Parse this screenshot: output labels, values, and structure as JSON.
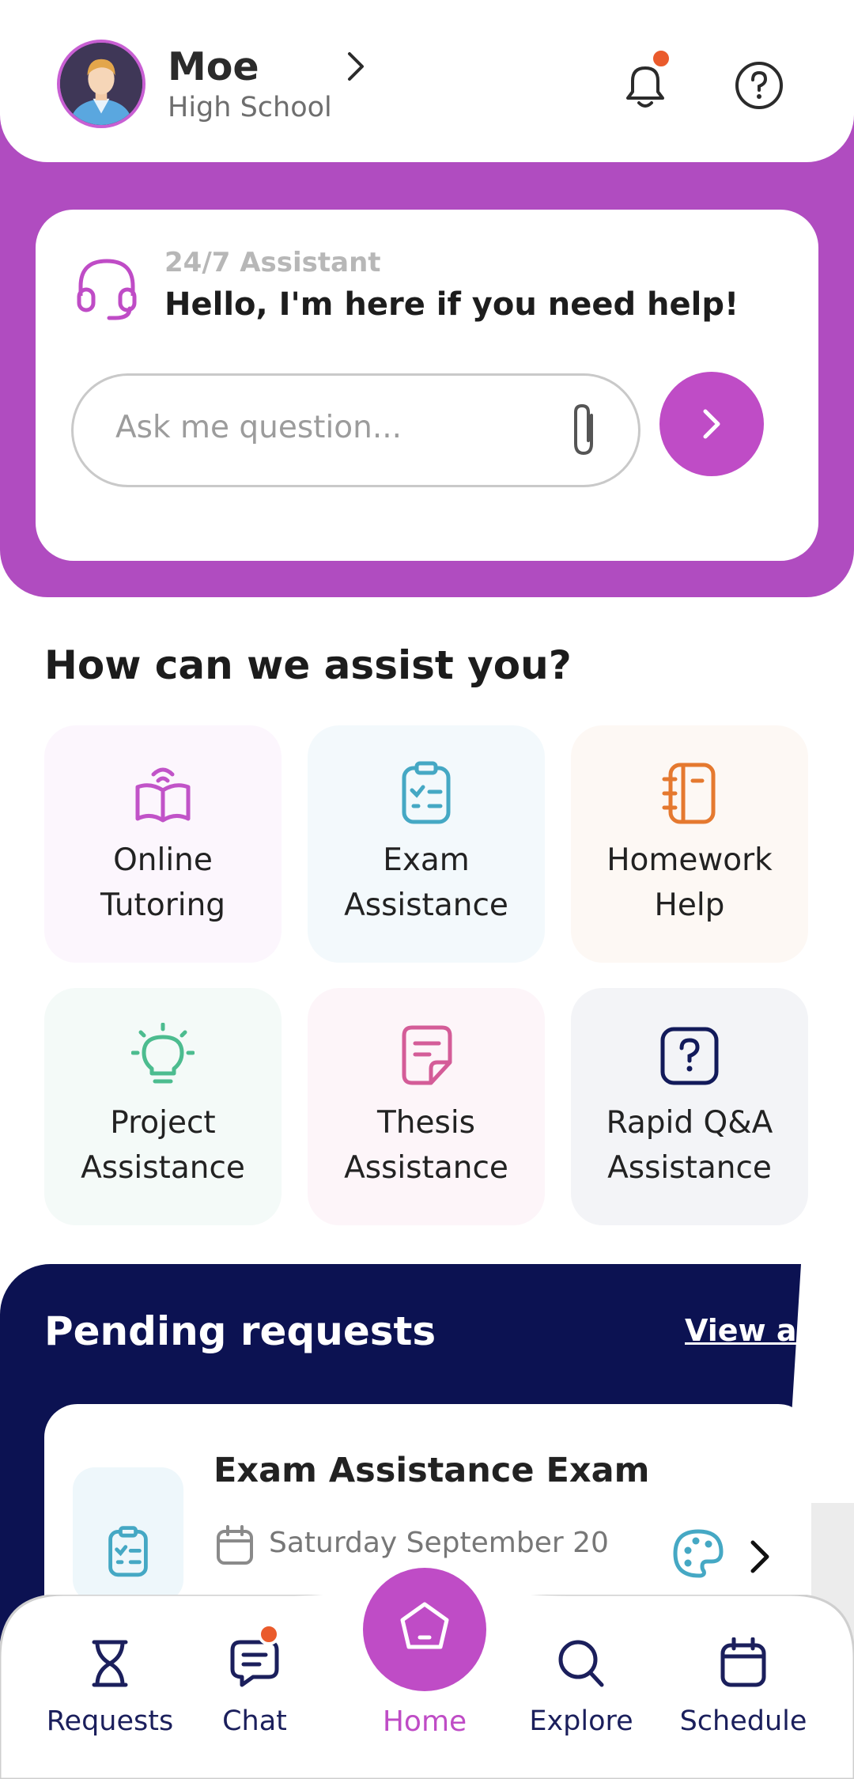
{
  "profile": {
    "name": "Moe",
    "level": "High School"
  },
  "assistant": {
    "kicker": "24/7 Assistant",
    "greeting": "Hello, I'm here if you need help!",
    "input_placeholder": "Ask me question..."
  },
  "services": {
    "title": "How can we assist you?",
    "items": [
      {
        "label": "Online\nTutoring",
        "icon": "open-book-icon",
        "color": "#c153c8",
        "bg": "#fcf6fd"
      },
      {
        "label": "Exam\nAssistance",
        "icon": "clipboard-check-icon",
        "color": "#45a8c4",
        "bg": "#f3f9fc"
      },
      {
        "label": "Homework\nHelp",
        "icon": "notebook-icon",
        "color": "#e5792f",
        "bg": "#fdf8f4"
      },
      {
        "label": "Project\nAssistance",
        "icon": "lightbulb-icon",
        "color": "#4cbc8f",
        "bg": "#f4faf8"
      },
      {
        "label": "Thesis\nAssistance",
        "icon": "document-icon",
        "color": "#d45c98",
        "bg": "#fdf5f9"
      },
      {
        "label": "Rapid Q&A\nAssistance",
        "icon": "question-box-icon",
        "color": "#121a5a",
        "bg": "#f3f4f7"
      }
    ]
  },
  "pending": {
    "title": "Pending requests",
    "view_all": "View all",
    "request": {
      "title": "Exam Assistance Exam",
      "date": "Saturday September 20"
    }
  },
  "nav": {
    "requests": "Requests",
    "chat": "Chat",
    "home": "Home",
    "explore": "Explore",
    "schedule": "Schedule"
  },
  "colors": {
    "accent": "#bf4cc6",
    "band": "#b04cc0",
    "navy": "#0c1252",
    "badge": "#ea5b2c"
  }
}
